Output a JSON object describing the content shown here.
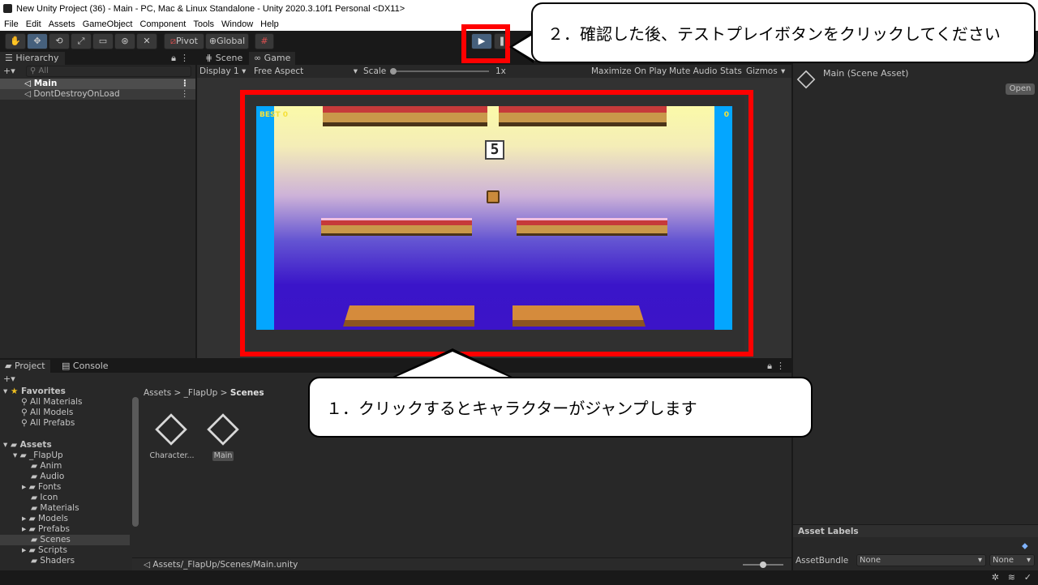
{
  "window": {
    "title": "New Unity Project (36) - Main - PC, Mac & Linux Standalone - Unity 2020.3.10f1 Personal <DX11>"
  },
  "menu": [
    "File",
    "Edit",
    "Assets",
    "GameObject",
    "Component",
    "Tools",
    "Window",
    "Help"
  ],
  "toolbar": {
    "pivot": "Pivot",
    "global": "Global"
  },
  "hierarchy": {
    "tab": "Hierarchy",
    "search_placeholder": "All",
    "items": [
      "Main",
      "DontDestroyOnLoad"
    ]
  },
  "scene_tabs": {
    "scene": "Scene",
    "game": "Game"
  },
  "game_bar": {
    "display": "Display 1",
    "aspect": "Free Aspect",
    "scale_label": "Scale",
    "scale_value": "1x",
    "maximize": "Maximize On Play",
    "mute": "Mute Audio",
    "stats": "Stats",
    "gizmos": "Gizmos"
  },
  "game": {
    "hud_left": "BEST 0",
    "hud_right": "0",
    "score": "5"
  },
  "inspector": {
    "title": "Main (Scene Asset)",
    "open": "Open",
    "asset_labels": "Asset Labels",
    "asset_bundle": "AssetBundle",
    "bundle_value": "None",
    "variant_value": "None"
  },
  "project": {
    "tab": "Project",
    "console_tab": "Console",
    "favorites": "Favorites",
    "fav_items": [
      "All Materials",
      "All Models",
      "All Prefabs"
    ],
    "assets": "Assets",
    "flapup": "_FlapUp",
    "folders": [
      "Anim",
      "Audio",
      "Fonts",
      "Icon",
      "Materials",
      "Models",
      "Prefabs",
      "Scenes",
      "Scripts",
      "Shaders"
    ],
    "breadcrumb": {
      "a": "Assets",
      "b": "_FlapUp",
      "c": "Scenes"
    },
    "files": [
      "Character...",
      "Main"
    ],
    "path": "Assets/_FlapUp/Scenes/Main.unity"
  },
  "callouts": {
    "step1": "１．クリックするとキャラクターがジャンプします",
    "step2": "２．確認した後、テストプレイボタンをクリックしてください"
  }
}
